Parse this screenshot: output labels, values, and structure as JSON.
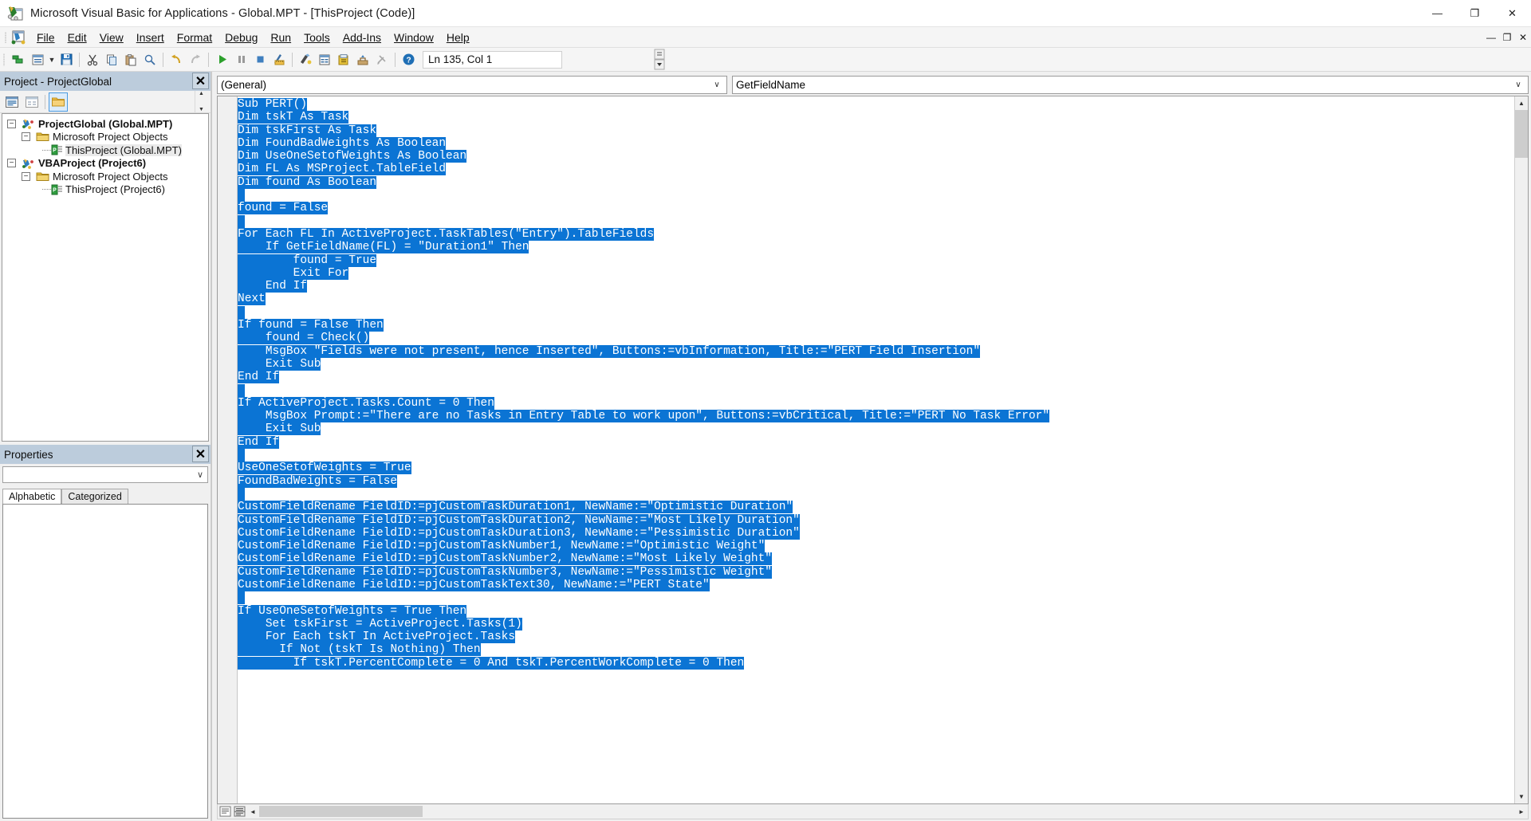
{
  "window": {
    "title": "Microsoft Visual Basic for Applications - Global.MPT - [ThisProject (Code)]",
    "minimize_label": "—",
    "maximize_label": "❐",
    "close_label": "✕",
    "mdi_minimize_label": "—",
    "mdi_restore_label": "❐",
    "mdi_close_label": "✕"
  },
  "menubar": {
    "items": [
      {
        "label": "File",
        "accel": "F"
      },
      {
        "label": "Edit",
        "accel": "E"
      },
      {
        "label": "View",
        "accel": "V"
      },
      {
        "label": "Insert",
        "accel": "I"
      },
      {
        "label": "Format",
        "accel": "o"
      },
      {
        "label": "Debug",
        "accel": "D"
      },
      {
        "label": "Run",
        "accel": "R"
      },
      {
        "label": "Tools",
        "accel": "T"
      },
      {
        "label": "Add-Ins",
        "accel": "A"
      },
      {
        "label": "Window",
        "accel": "W"
      },
      {
        "label": "Help",
        "accel": "H"
      }
    ]
  },
  "toolbar": {
    "buttons": [
      {
        "name": "view-microsoft-project-icon",
        "tooltip": "View Microsoft Project"
      },
      {
        "name": "insert-userform-icon",
        "tooltip": "Insert"
      },
      {
        "name": "insert-dropdown-caret-icon",
        "tooltip": "Insert menu"
      },
      {
        "name": "save-icon",
        "tooltip": "Save Global.MPT"
      },
      {
        "name": "cut-icon",
        "tooltip": "Cut"
      },
      {
        "name": "copy-icon",
        "tooltip": "Copy"
      },
      {
        "name": "paste-icon",
        "tooltip": "Paste"
      },
      {
        "name": "find-icon",
        "tooltip": "Find"
      },
      {
        "name": "undo-icon",
        "tooltip": "Undo"
      },
      {
        "name": "redo-icon",
        "tooltip": "Redo"
      },
      {
        "name": "run-icon",
        "tooltip": "Run Sub/UserForm"
      },
      {
        "name": "break-icon",
        "tooltip": "Break"
      },
      {
        "name": "reset-icon",
        "tooltip": "Reset"
      },
      {
        "name": "design-mode-icon",
        "tooltip": "Design Mode"
      },
      {
        "name": "project-explorer-icon",
        "tooltip": "Project Explorer"
      },
      {
        "name": "properties-window-icon",
        "tooltip": "Properties Window"
      },
      {
        "name": "object-browser-icon",
        "tooltip": "Object Browser"
      },
      {
        "name": "toolbox-icon",
        "tooltip": "Toolbox"
      },
      {
        "name": "help-icon",
        "tooltip": "Microsoft Visual Basic for Applications Help"
      }
    ],
    "position_indicator": "Ln 135, Col 1"
  },
  "project_explorer": {
    "title": "Project - ProjectGlobal",
    "close_label": "✕",
    "toolbar": [
      {
        "name": "view-code-icon",
        "tooltip": "View Code",
        "active": false
      },
      {
        "name": "view-object-icon",
        "tooltip": "View Object",
        "active": false
      },
      {
        "name": "toggle-folders-icon",
        "tooltip": "Toggle Folders",
        "active": true
      }
    ],
    "tree": [
      {
        "label": "ProjectGlobal (Global.MPT)",
        "level": 0,
        "icon": "vba-project-icon",
        "expander": "-",
        "bold": true,
        "selected": false
      },
      {
        "label": "Microsoft Project Objects",
        "level": 1,
        "icon": "folder-icon",
        "expander": "-",
        "bold": false,
        "selected": false
      },
      {
        "label": "ThisProject (Global.MPT)",
        "level": 2,
        "icon": "project-module-icon",
        "expander": "",
        "bold": false,
        "selected": true
      },
      {
        "label": "VBAProject (Project6)",
        "level": 0,
        "icon": "vba-project-icon",
        "expander": "-",
        "bold": true,
        "selected": false
      },
      {
        "label": "Microsoft Project Objects",
        "level": 1,
        "icon": "folder-icon",
        "expander": "-",
        "bold": false,
        "selected": false
      },
      {
        "label": "ThisProject (Project6)",
        "level": 2,
        "icon": "project-module-icon",
        "expander": "",
        "bold": false,
        "selected": false
      }
    ]
  },
  "properties_window": {
    "title": "Properties",
    "close_label": "✕",
    "object_combo_value": "",
    "tabs": [
      {
        "label": "Alphabetic",
        "active": true
      },
      {
        "label": "Categorized",
        "active": false
      }
    ]
  },
  "code_window": {
    "object_dropdown": "(General)",
    "procedure_dropdown": "GetFieldName",
    "dropdown_arrow": "∨",
    "lines": [
      {
        "text": "Sub PERT()",
        "selected": true
      },
      {
        "text": "Dim tskT As Task",
        "selected": true
      },
      {
        "text": "Dim tskFirst As Task",
        "selected": true
      },
      {
        "text": "Dim FoundBadWeights As Boolean",
        "selected": true
      },
      {
        "text": "Dim UseOneSetofWeights As Boolean",
        "selected": true
      },
      {
        "text": "Dim FL As MSProject.TableField",
        "selected": true
      },
      {
        "text": "Dim found As Boolean",
        "selected": true
      },
      {
        "text": "",
        "selected": true
      },
      {
        "text": "found = False",
        "selected": true
      },
      {
        "text": "",
        "selected": true
      },
      {
        "text": "For Each FL In ActiveProject.TaskTables(\"Entry\").TableFields",
        "selected": true
      },
      {
        "text": "    If GetFieldName(FL) = \"Duration1\" Then",
        "selected": true
      },
      {
        "text": "        found = True",
        "selected": true
      },
      {
        "text": "        Exit For",
        "selected": true
      },
      {
        "text": "    End If",
        "selected": true
      },
      {
        "text": "Next",
        "selected": true
      },
      {
        "text": "",
        "selected": true
      },
      {
        "text": "If found = False Then",
        "selected": true
      },
      {
        "text": "    found = Check()",
        "selected": true
      },
      {
        "text": "    MsgBox \"Fields were not present, hence Inserted\", Buttons:=vbInformation, Title:=\"PERT Field Insertion\"",
        "selected": true
      },
      {
        "text": "    Exit Sub",
        "selected": true
      },
      {
        "text": "End If",
        "selected": true
      },
      {
        "text": "",
        "selected": true
      },
      {
        "text": "If ActiveProject.Tasks.Count = 0 Then",
        "selected": true
      },
      {
        "text": "    MsgBox Prompt:=\"There are no Tasks in Entry Table to work upon\", Buttons:=vbCritical, Title:=\"PERT No Task Error\"",
        "selected": true
      },
      {
        "text": "    Exit Sub",
        "selected": true
      },
      {
        "text": "End If",
        "selected": true
      },
      {
        "text": "",
        "selected": true
      },
      {
        "text": "UseOneSetofWeights = True",
        "selected": true
      },
      {
        "text": "FoundBadWeights = False",
        "selected": true
      },
      {
        "text": "",
        "selected": true
      },
      {
        "text": "CustomFieldRename FieldID:=pjCustomTaskDuration1, NewName:=\"Optimistic Duration\"",
        "selected": true
      },
      {
        "text": "CustomFieldRename FieldID:=pjCustomTaskDuration2, NewName:=\"Most Likely Duration\"",
        "selected": true
      },
      {
        "text": "CustomFieldRename FieldID:=pjCustomTaskDuration3, NewName:=\"Pessimistic Duration\"",
        "selected": true
      },
      {
        "text": "CustomFieldRename FieldID:=pjCustomTaskNumber1, NewName:=\"Optimistic Weight\"",
        "selected": true
      },
      {
        "text": "CustomFieldRename FieldID:=pjCustomTaskNumber2, NewName:=\"Most Likely Weight\"",
        "selected": true
      },
      {
        "text": "CustomFieldRename FieldID:=pjCustomTaskNumber3, NewName:=\"Pessimistic Weight\"",
        "selected": true
      },
      {
        "text": "CustomFieldRename FieldID:=pjCustomTaskText30, NewName:=\"PERT State\"",
        "selected": true
      },
      {
        "text": "",
        "selected": true
      },
      {
        "text": "If UseOneSetofWeights = True Then",
        "selected": true
      },
      {
        "text": "    Set tskFirst = ActiveProject.Tasks(1)",
        "selected": true
      },
      {
        "text": "    For Each tskT In ActiveProject.Tasks",
        "selected": true
      },
      {
        "text": "      If Not (tskT Is Nothing) Then",
        "selected": true
      },
      {
        "text": "        If tskT.PercentComplete = 0 And tskT.PercentWorkComplete = 0 Then",
        "selected": true
      }
    ],
    "scroll_up_arrow": "▲",
    "scroll_down_arrow": "▼",
    "scroll_left_arrow": "◄",
    "scroll_right_arrow": "►",
    "view_buttons": [
      {
        "name": "procedure-view-icon",
        "tooltip": "Procedure View"
      },
      {
        "name": "full-module-view-icon",
        "tooltip": "Full Module View"
      }
    ]
  },
  "colors": {
    "selection_blue": "#0b74d4",
    "pane_title_bg": "#bcccdc",
    "chrome_bg": "#f0f0f0",
    "accent_folder": "#e0a72c"
  }
}
